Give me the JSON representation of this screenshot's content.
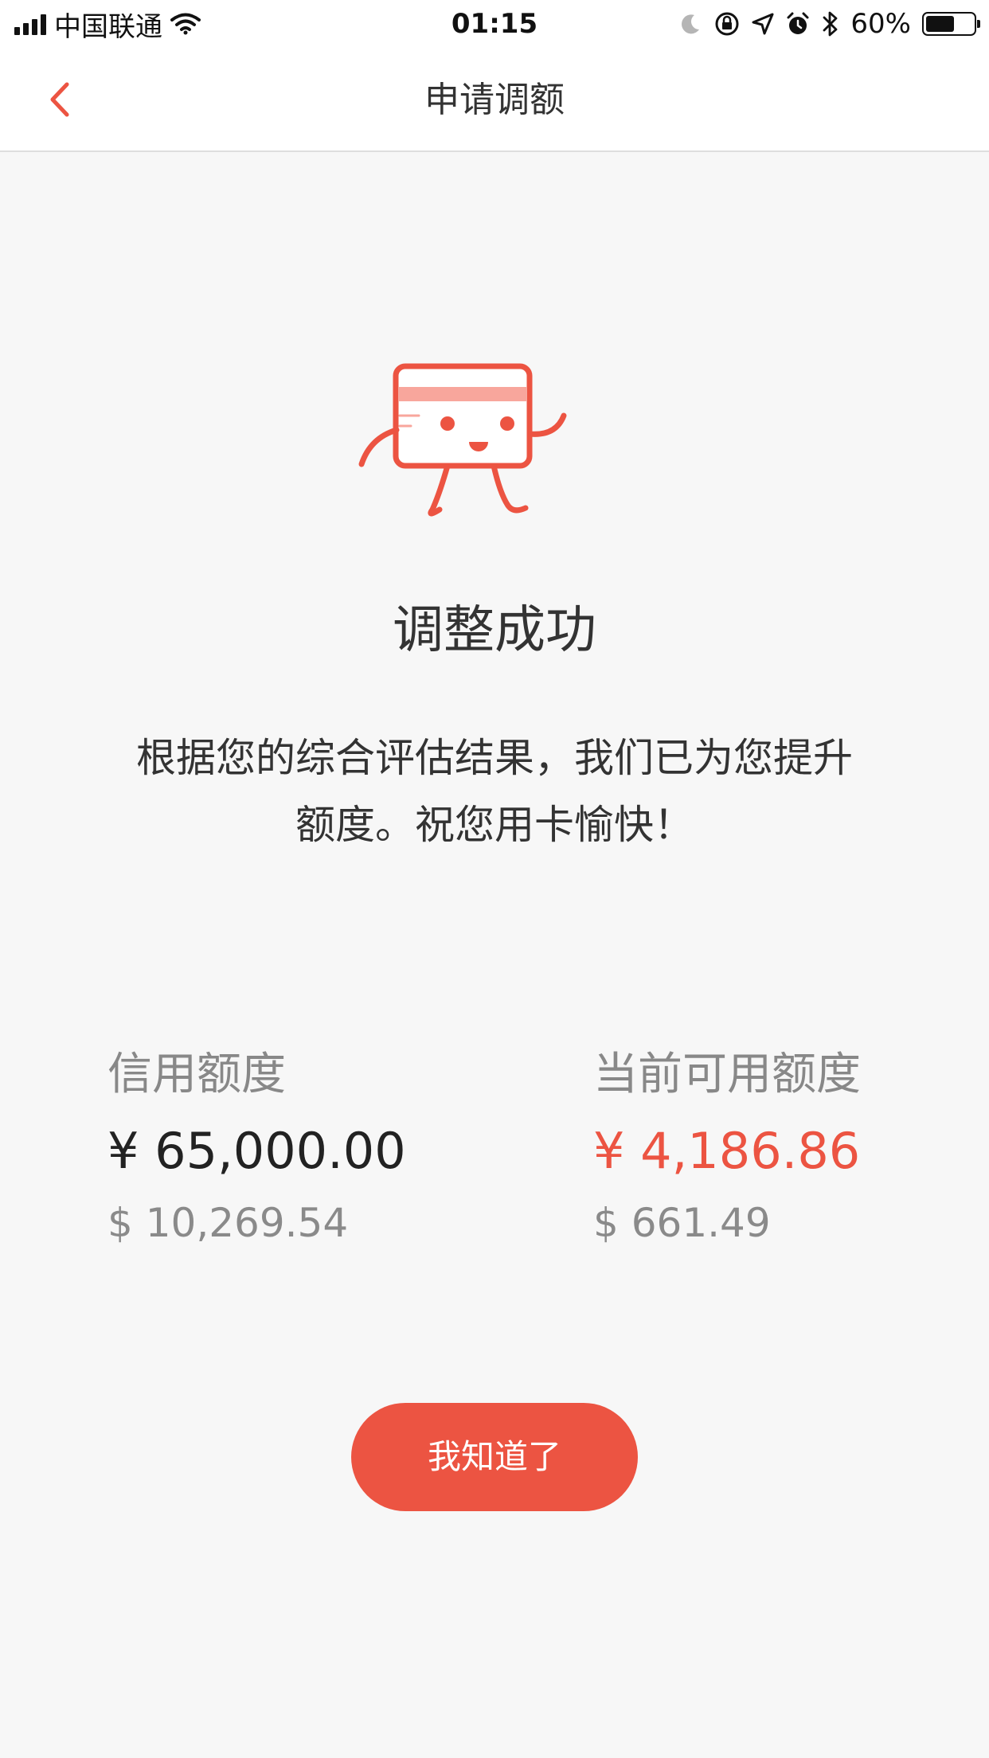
{
  "status_bar": {
    "carrier": "中国联通",
    "time": "01:15",
    "battery_percent": "60%",
    "battery_level": 0.6,
    "icons": [
      "signal-icon",
      "wifi-icon",
      "moon-icon",
      "rotation-lock-icon",
      "location-icon",
      "alarm-icon",
      "bluetooth-icon",
      "battery-icon"
    ]
  },
  "nav": {
    "title": "申请调额",
    "back_icon": "chevron-left-icon"
  },
  "result": {
    "title": "调整成功",
    "description": "根据您的综合评估结果，我们已为您提升额度。祝您用卡愉快！"
  },
  "limits": {
    "credit": {
      "label": "信用额度",
      "cny": "¥ 65,000.00",
      "usd": "$ 10,269.54"
    },
    "available": {
      "label": "当前可用额度",
      "cny": "¥ 4,186.86",
      "usd": "$ 661.49"
    }
  },
  "confirm_button": "我知道了",
  "colors": {
    "accent": "#ec5442",
    "mascot_stripe": "#f8a69c",
    "background": "#f7f7f7"
  }
}
